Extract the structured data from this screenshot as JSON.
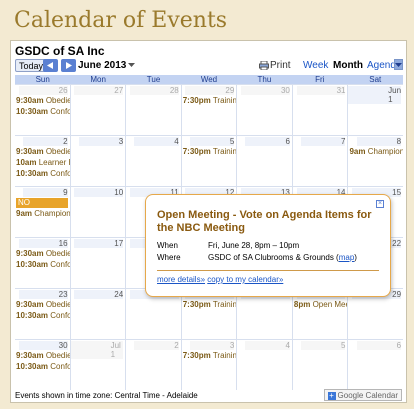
{
  "page": {
    "title": "Calendar of Events"
  },
  "calendar": {
    "name": "GSDC of SA Inc",
    "toolbar": {
      "today_label": "Today",
      "month_label": "June 2013",
      "print_label": "Print",
      "views": [
        "Week",
        "Month",
        "Agenda"
      ],
      "active_view": "Month"
    },
    "weekdays": [
      "Sun",
      "Mon",
      "Tue",
      "Wed",
      "Thu",
      "Fri",
      "Sat"
    ],
    "weeks": [
      {
        "days": [
          {
            "num": "26",
            "other": true,
            "events": [
              {
                "time": "9:30am",
                "title": "Obedien"
              },
              {
                "time": "10:30am",
                "title": "Conforr"
              }
            ]
          },
          {
            "num": "27",
            "other": true,
            "events": []
          },
          {
            "num": "28",
            "other": true,
            "events": []
          },
          {
            "num": "29",
            "other": true,
            "events": [
              {
                "time": "7:30pm",
                "title": "Training"
              }
            ]
          },
          {
            "num": "30",
            "other": true,
            "events": []
          },
          {
            "num": "31",
            "other": true,
            "events": []
          },
          {
            "num": "Jun 1",
            "other": false,
            "events": []
          }
        ]
      },
      {
        "days": [
          {
            "num": "2",
            "events": [
              {
                "time": "9:30am",
                "title": "Obedien"
              },
              {
                "time": "10am",
                "title": "Learner H"
              },
              {
                "time": "10:30am",
                "title": "Conforr"
              }
            ]
          },
          {
            "num": "3",
            "events": []
          },
          {
            "num": "4",
            "events": []
          },
          {
            "num": "5",
            "events": [
              {
                "time": "7:30pm",
                "title": "Training"
              }
            ]
          },
          {
            "num": "6",
            "events": []
          },
          {
            "num": "7",
            "events": []
          },
          {
            "num": "8",
            "events": [
              {
                "time": "9am",
                "title": "Champions"
              }
            ]
          }
        ]
      },
      {
        "days": [
          {
            "num": "9",
            "allday": "NO TRAINING",
            "events": [
              {
                "time": "9am",
                "title": "Champions"
              }
            ]
          },
          {
            "num": "10",
            "events": []
          },
          {
            "num": "11",
            "events": []
          },
          {
            "num": "12",
            "events": []
          },
          {
            "num": "13",
            "events": []
          },
          {
            "num": "14",
            "events": []
          },
          {
            "num": "15",
            "events": []
          }
        ]
      },
      {
        "days": [
          {
            "num": "16",
            "events": [
              {
                "time": "9:30am",
                "title": "Obedien"
              },
              {
                "time": "10:30am",
                "title": "Conforr"
              }
            ]
          },
          {
            "num": "17",
            "events": []
          },
          {
            "num": "18",
            "events": []
          },
          {
            "num": "19",
            "events": []
          },
          {
            "num": "20",
            "events": []
          },
          {
            "num": "21",
            "events": []
          },
          {
            "num": "22",
            "events": []
          }
        ]
      },
      {
        "days": [
          {
            "num": "23",
            "events": [
              {
                "time": "9:30am",
                "title": "Obedien"
              },
              {
                "time": "10:30am",
                "title": "Conforr"
              }
            ]
          },
          {
            "num": "24",
            "events": []
          },
          {
            "num": "25",
            "events": []
          },
          {
            "num": "26",
            "events": [
              {
                "time": "7:30pm",
                "title": "Training"
              }
            ]
          },
          {
            "num": "27",
            "events": []
          },
          {
            "num": "28",
            "events": [
              {
                "time": "8pm",
                "title": "Open Meet"
              }
            ]
          },
          {
            "num": "29",
            "events": []
          }
        ]
      },
      {
        "days": [
          {
            "num": "30",
            "events": [
              {
                "time": "9:30am",
                "title": "Obedien"
              },
              {
                "time": "10:30am",
                "title": "Conforr"
              }
            ]
          },
          {
            "num": "Jul 1",
            "other": true,
            "events": []
          },
          {
            "num": "2",
            "other": true,
            "events": []
          },
          {
            "num": "3",
            "other": true,
            "events": [
              {
                "time": "7:30pm",
                "title": "Training"
              }
            ]
          },
          {
            "num": "4",
            "other": true,
            "events": []
          },
          {
            "num": "5",
            "other": true,
            "events": []
          },
          {
            "num": "6",
            "other": true,
            "events": []
          }
        ]
      }
    ],
    "footer": {
      "timezone": "Events shown in time zone: Central Time - Adelaide",
      "google_button": "Google Calendar"
    },
    "bubble": {
      "title": "Open Meeting - Vote on Agenda Items for the NBC Meeting",
      "when_label": "When",
      "when_value": "Fri, June 28, 8pm – 10pm",
      "where_label": "Where",
      "where_value": "GSDC of SA Clubrooms & Grounds (",
      "map_link": "map",
      "where_close": ")",
      "more_details": "more details»",
      "copy_link": "copy to my calendar»"
    }
  }
}
